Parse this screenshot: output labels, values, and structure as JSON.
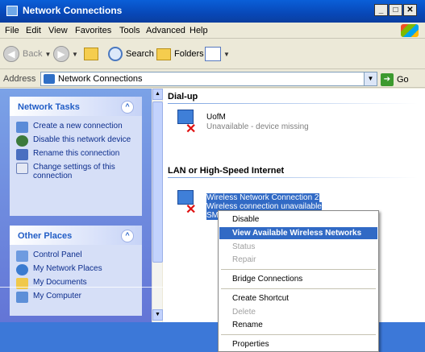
{
  "window": {
    "title": "Network Connections",
    "caption_buttons": {
      "minimize": "_",
      "maximize": "□",
      "close": "✕"
    }
  },
  "menubar": [
    "File",
    "Edit",
    "View",
    "Favorites",
    "Tools",
    "Advanced",
    "Help"
  ],
  "toolbar": {
    "back": "Back",
    "search": "Search",
    "folders": "Folders"
  },
  "address": {
    "label": "Address",
    "value": "Network Connections",
    "go": "Go"
  },
  "network_tasks": {
    "header": "Network Tasks",
    "items": [
      "Create a new connection",
      "Disable this network device",
      "Rename this connection",
      "Change settings of this connection"
    ]
  },
  "other_places": {
    "header": "Other Places",
    "items": [
      "Control Panel",
      "My Network Places",
      "My Documents",
      "My Computer"
    ]
  },
  "groups": {
    "dialup": {
      "header": "Dial-up",
      "connection": {
        "name": "UofM",
        "status": "Unavailable - device missing"
      }
    },
    "lan": {
      "header": "LAN or High-Speed Internet",
      "connection": {
        "name": "Wireless Network Connection 2",
        "status": "Wireless connection unavailable",
        "device": "SMC"
      }
    }
  },
  "context_menu": {
    "items": [
      {
        "label": "Disable",
        "state": "normal"
      },
      {
        "label": "View Available Wireless Networks",
        "state": "highlighted"
      },
      {
        "label": "Status",
        "state": "disabled"
      },
      {
        "label": "Repair",
        "state": "disabled"
      },
      {
        "label": "Bridge Connections",
        "state": "normal"
      },
      {
        "label": "Create Shortcut",
        "state": "normal"
      },
      {
        "label": "Delete",
        "state": "disabled"
      },
      {
        "label": "Rename",
        "state": "normal"
      },
      {
        "label": "Properties",
        "state": "normal"
      }
    ]
  },
  "colors": {
    "titlebar": "#0A5FD8",
    "selection": "#316AC5",
    "task_pane": "#6375D6",
    "link_text": "#0C2D8C"
  }
}
